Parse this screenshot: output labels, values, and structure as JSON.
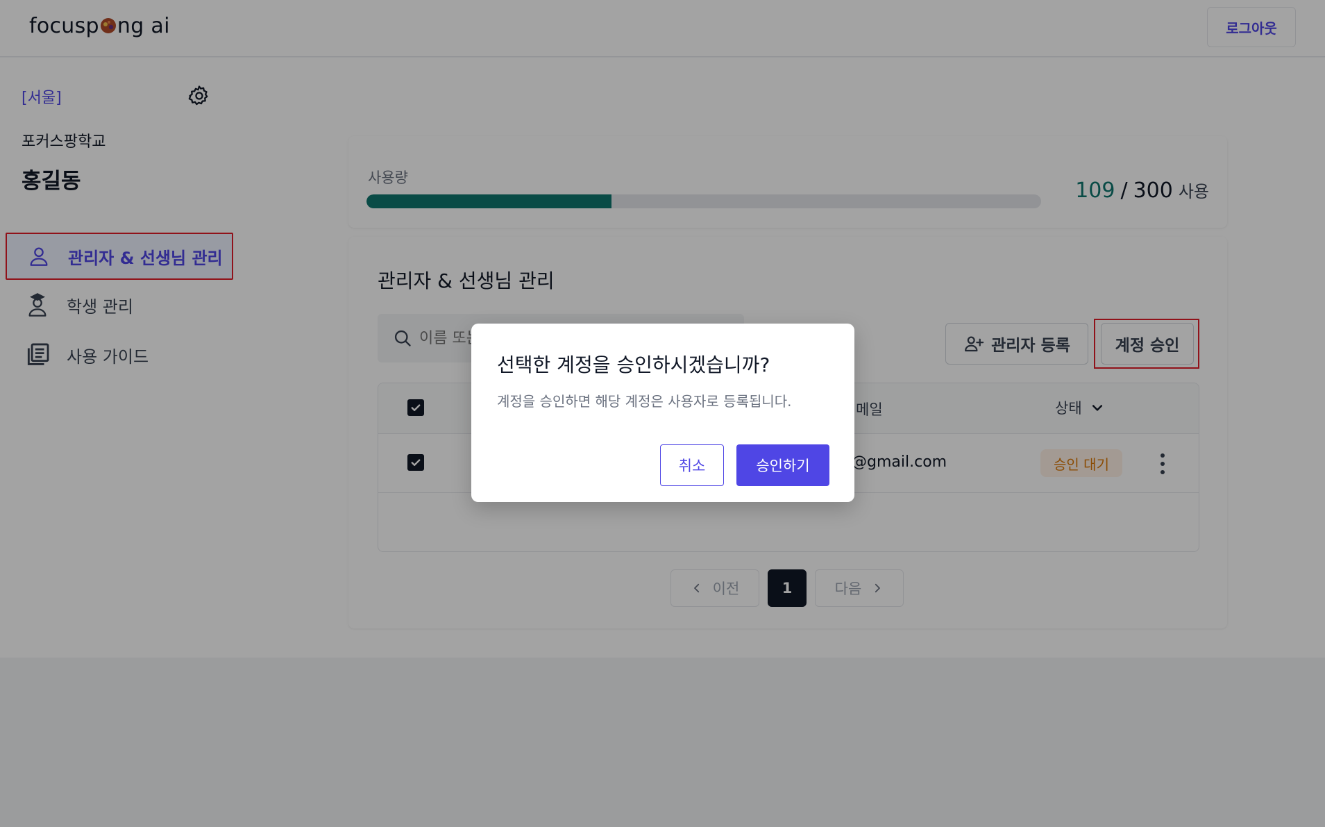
{
  "header": {
    "logo_text": "focusp",
    "logo_suffix": "ng ai",
    "logout_label": "로그아웃"
  },
  "sidebar": {
    "region": "[서울]",
    "school": "포커스팡학교",
    "user_name": "홍길동",
    "items": [
      {
        "label": "관리자 & 선생님 관리",
        "icon": "person-icon",
        "active": true
      },
      {
        "label": "학생 관리",
        "icon": "student-icon",
        "active": false
      },
      {
        "label": "사용 가이드",
        "icon": "book-stack-icon",
        "active": false
      }
    ]
  },
  "usage": {
    "label": "사용량",
    "current": "109",
    "separator": "/",
    "max": "300",
    "unit": "사용",
    "fraction": 0.363
  },
  "management": {
    "title": "관리자 & 선생님 관리",
    "search_placeholder": "이름 또는",
    "register_label": "관리자 등록",
    "approve_label": "계정 승인",
    "table": {
      "headers": {
        "email": "메일",
        "status": "상태"
      },
      "rows": [
        {
          "checked": true,
          "email": "@gmail.com",
          "status": "승인 대기"
        }
      ]
    },
    "pagination": {
      "prev_label": "이전",
      "current_page": "1",
      "next_label": "다음"
    }
  },
  "modal": {
    "title": "선택한 계정을 승인하시겠습니까?",
    "description": "계정을 승인하면 해당 계정은 사용자로 등록됩니다.",
    "cancel_label": "취소",
    "confirm_label": "승인하기"
  },
  "colors": {
    "accent": "#4f46e5",
    "progress": "#0f766e",
    "highlight_border": "#e11d2a",
    "pending": "#d97706"
  }
}
